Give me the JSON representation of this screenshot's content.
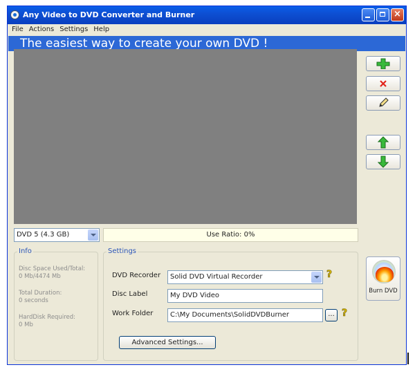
{
  "window": {
    "title": "Any Video to DVD Converter and Burner"
  },
  "menu": [
    "File",
    "Actions",
    "Settings",
    "Help"
  ],
  "banner": "The easiest way to create your own DVD !",
  "toolbar_icons": [
    "add-icon",
    "remove-icon",
    "edit-icon",
    "move-up-icon",
    "move-down-icon"
  ],
  "disc_size": {
    "selected": "DVD 5  (4.3 GB)"
  },
  "use_ratio": {
    "text": "Use Ratio: 0%",
    "value": 0
  },
  "info": {
    "legend": "Info",
    "disc_space_label": "Disc Space Used/Total:",
    "disc_space_value": "0 Mb/4474 Mb",
    "duration_label": "Total Duration:",
    "duration_value": "0 seconds",
    "harddisk_label": "HardDisk Required:",
    "harddisk_value": "0 Mb"
  },
  "settings": {
    "legend": "Settings",
    "recorder_label": "DVD Recorder",
    "recorder_value": "Solid DVD Virtual Recorder",
    "disc_label_label": "Disc Label",
    "disc_label_value": "My DVD Video",
    "work_folder_label": "Work Folder",
    "work_folder_value": "C:\\My Documents\\SolidDVDBurner",
    "browse_label": "...",
    "advanced_label": "Advanced Settings..."
  },
  "burn": {
    "label": "Burn DVD"
  },
  "colors": {
    "banner": "#2C68D6",
    "titlebar": "#0A5FE8",
    "preview": "#808080",
    "ratio_bg": "#FFFFE8"
  }
}
